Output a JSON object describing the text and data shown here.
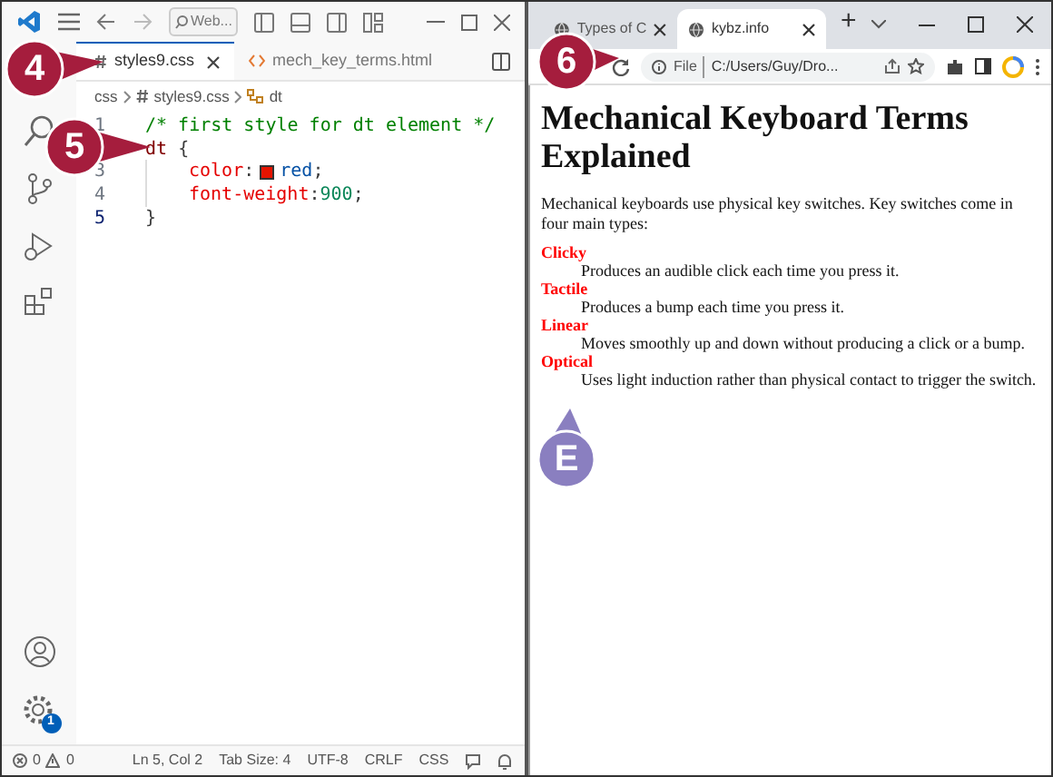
{
  "editor": {
    "search_placeholder": "Web...",
    "tabs": [
      {
        "label": "styles9.css",
        "kind": "css",
        "selected": true
      },
      {
        "label": "mech_key_terms.html",
        "kind": "html",
        "selected": false
      }
    ],
    "breadcrumb": [
      "css",
      "styles9.css",
      "dt"
    ],
    "lines": [
      {
        "number": "1",
        "current": false,
        "tokens": [
          {
            "kind": "comment",
            "text": "/* first style for dt element */"
          }
        ]
      },
      {
        "tokens": [
          {
            "kind": "selector",
            "text": "dt "
          },
          {
            "kind": "punct",
            "text": "{"
          }
        ]
      },
      {
        "number": "3",
        "current": false,
        "tokens": [
          {
            "kind": "indent"
          },
          {
            "kind": "property",
            "text": "color"
          },
          {
            "kind": "plain",
            "text": ":"
          },
          {
            "kind": "swatch",
            "color": "#e51400"
          },
          {
            "kind": "value",
            "text": "red"
          },
          {
            "kind": "plain",
            "text": ";"
          }
        ]
      },
      {
        "number": "4",
        "current": false,
        "tokens": [
          {
            "kind": "indent"
          },
          {
            "kind": "property",
            "text": "font-weight"
          },
          {
            "kind": "plain",
            "text": ":"
          },
          {
            "kind": "number",
            "text": "900"
          },
          {
            "kind": "plain",
            "text": ";"
          }
        ]
      },
      {
        "number": "5",
        "current": true,
        "tokens": [
          {
            "kind": "punct",
            "text": "}"
          }
        ]
      }
    ],
    "settings_badge": "1",
    "status": {
      "errors": "0",
      "warnings": "0",
      "items": [
        "Ln 5, Col 2",
        "Tab Size: 4",
        "UTF-8",
        "CRLF",
        "CSS"
      ]
    }
  },
  "browser": {
    "tabs": [
      {
        "label": "Types of C",
        "selected": false
      },
      {
        "label": "kybz.info",
        "selected": true
      }
    ],
    "new_tab": "+",
    "address": {
      "scheme": "File",
      "url": "C:/Users/Guy/Dro..."
    },
    "page": {
      "heading": "Mechanical Keyboard Terms Explained",
      "intro": "Mechanical keyboards use physical key switches. Key switches come in four main types:",
      "terms": [
        {
          "term": "Clicky",
          "definition": "Produces an audible click each time you press it."
        },
        {
          "term": "Tactile",
          "definition": "Produces a bump each time you press it."
        },
        {
          "term": "Linear",
          "definition": "Moves smoothly up and down without producing a click or a bump."
        },
        {
          "term": "Optical",
          "definition": "Uses light induction rather than physical contact to trigger the switch."
        }
      ]
    }
  },
  "callouts": [
    {
      "label": "4",
      "color": "#a51d3d"
    },
    {
      "label": "5",
      "color": "#a51d3d"
    },
    {
      "label": "6",
      "color": "#a51d3d"
    },
    {
      "label": "E",
      "color": "#8a7fc0"
    }
  ]
}
